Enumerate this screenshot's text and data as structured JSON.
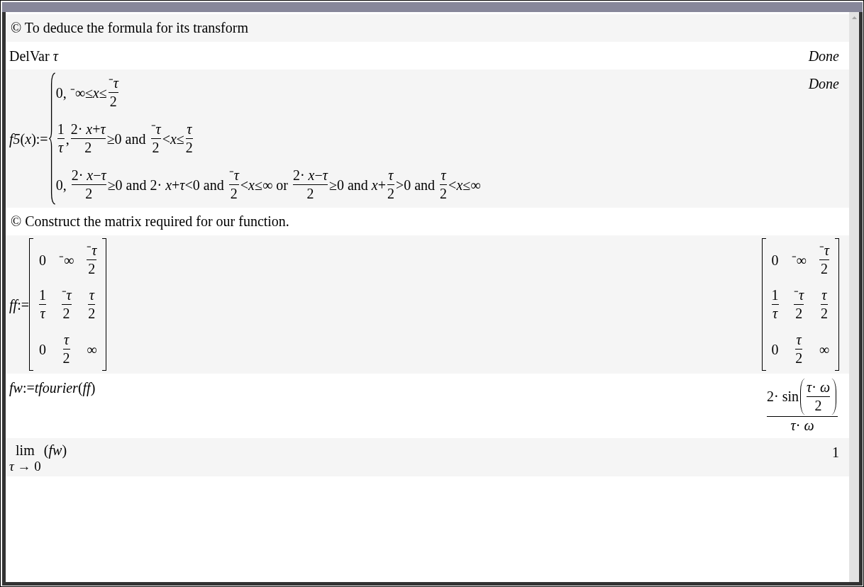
{
  "entries": [
    {
      "kind": "comment",
      "text": "© To deduce the formula for its transform"
    },
    {
      "kind": "math",
      "input": [
        {
          "kind": "text",
          "text": "DelVar *τ*"
        }
      ],
      "output": [
        {
          "kind": "text",
          "text": "Done",
          "italic": true
        }
      ]
    },
    {
      "kind": "math",
      "input": [
        {
          "kind": "text",
          "text": "*f5*(*x*):="
        },
        {
          "kind": "piecewise",
          "cases": [
            [
              {
                "kind": "text",
                "text": "0, ⁻∞≤*x*≤"
              },
              {
                "kind": "frac",
                "num": [
                  {
                    "kind": "text",
                    "text": "⁻*τ*"
                  }
                ],
                "den": [
                  {
                    "kind": "text",
                    "text": "2"
                  }
                ]
              }
            ],
            [
              {
                "kind": "frac",
                "num": [
                  {
                    "kind": "text",
                    "text": "1"
                  }
                ],
                "den": [
                  {
                    "kind": "text",
                    "text": "τ",
                    "italic": true
                  }
                ]
              },
              {
                "kind": "text",
                "text": ","
              },
              {
                "kind": "frac",
                "num": [
                  {
                    "kind": "text",
                    "text": "2· *x*+*τ*"
                  }
                ],
                "den": [
                  {
                    "kind": "text",
                    "text": "2"
                  }
                ]
              },
              {
                "kind": "text",
                "text": "≥0 and "
              },
              {
                "kind": "frac",
                "num": [
                  {
                    "kind": "text",
                    "text": "⁻*τ*"
                  }
                ],
                "den": [
                  {
                    "kind": "text",
                    "text": "2"
                  }
                ]
              },
              {
                "kind": "text",
                "text": "<*x*≤"
              },
              {
                "kind": "frac",
                "num": [
                  {
                    "kind": "text",
                    "text": "τ",
                    "italic": true
                  }
                ],
                "den": [
                  {
                    "kind": "text",
                    "text": "2"
                  }
                ]
              }
            ],
            [
              {
                "kind": "text",
                "text": "0, "
              },
              {
                "kind": "frac",
                "num": [
                  {
                    "kind": "text",
                    "text": "2· *x*−*τ*"
                  }
                ],
                "den": [
                  {
                    "kind": "text",
                    "text": "2"
                  }
                ]
              },
              {
                "kind": "text",
                "text": "≥0 and 2· *x*+*τ*<0 and "
              },
              {
                "kind": "frac",
                "num": [
                  {
                    "kind": "text",
                    "text": "⁻*τ*"
                  }
                ],
                "den": [
                  {
                    "kind": "text",
                    "text": "2"
                  }
                ]
              },
              {
                "kind": "text",
                "text": "<*x*≤∞ or "
              },
              {
                "kind": "frac",
                "num": [
                  {
                    "kind": "text",
                    "text": "2· *x*−*τ*"
                  }
                ],
                "den": [
                  {
                    "kind": "text",
                    "text": "2"
                  }
                ]
              },
              {
                "kind": "text",
                "text": "≥0 and *x*+"
              },
              {
                "kind": "frac",
                "num": [
                  {
                    "kind": "text",
                    "text": "τ",
                    "italic": true
                  }
                ],
                "den": [
                  {
                    "kind": "text",
                    "text": "2"
                  }
                ]
              },
              {
                "kind": "text",
                "text": ">0 and "
              },
              {
                "kind": "frac",
                "num": [
                  {
                    "kind": "text",
                    "text": "τ",
                    "italic": true
                  }
                ],
                "den": [
                  {
                    "kind": "text",
                    "text": "2"
                  }
                ]
              },
              {
                "kind": "text",
                "text": "<*x*≤∞"
              }
            ]
          ]
        }
      ],
      "output": [
        {
          "kind": "text",
          "text": "Done",
          "italic": true
        }
      ]
    },
    {
      "kind": "comment",
      "text": "© Construct the matrix required for our function."
    },
    {
      "kind": "math",
      "input": [
        {
          "kind": "text",
          "text": "*ff*:="
        },
        {
          "kind": "matrix",
          "rows": [
            [
              [
                {
                  "kind": "text",
                  "text": "0"
                }
              ],
              [
                {
                  "kind": "text",
                  "text": "⁻∞"
                }
              ],
              [
                {
                  "kind": "frac",
                  "num": [
                    {
                      "kind": "text",
                      "text": "⁻*τ*"
                    }
                  ],
                  "den": [
                    {
                      "kind": "text",
                      "text": "2"
                    }
                  ]
                }
              ]
            ],
            [
              [
                {
                  "kind": "frac",
                  "num": [
                    {
                      "kind": "text",
                      "text": "1"
                    }
                  ],
                  "den": [
                    {
                      "kind": "text",
                      "text": "τ",
                      "italic": true
                    }
                  ]
                }
              ],
              [
                {
                  "kind": "frac",
                  "num": [
                    {
                      "kind": "text",
                      "text": "⁻*τ*"
                    }
                  ],
                  "den": [
                    {
                      "kind": "text",
                      "text": "2"
                    }
                  ]
                }
              ],
              [
                {
                  "kind": "frac",
                  "num": [
                    {
                      "kind": "text",
                      "text": "τ",
                      "italic": true
                    }
                  ],
                  "den": [
                    {
                      "kind": "text",
                      "text": "2"
                    }
                  ]
                }
              ]
            ],
            [
              [
                {
                  "kind": "text",
                  "text": "0"
                }
              ],
              [
                {
                  "kind": "frac",
                  "num": [
                    {
                      "kind": "text",
                      "text": "τ",
                      "italic": true
                    }
                  ],
                  "den": [
                    {
                      "kind": "text",
                      "text": "2"
                    }
                  ]
                }
              ],
              [
                {
                  "kind": "text",
                  "text": "∞"
                }
              ]
            ]
          ]
        }
      ],
      "output": [
        {
          "kind": "matrix",
          "rows": [
            [
              [
                {
                  "kind": "text",
                  "text": "0"
                }
              ],
              [
                {
                  "kind": "text",
                  "text": "⁻∞"
                }
              ],
              [
                {
                  "kind": "frac",
                  "num": [
                    {
                      "kind": "text",
                      "text": "⁻*τ*"
                    }
                  ],
                  "den": [
                    {
                      "kind": "text",
                      "text": "2"
                    }
                  ]
                }
              ]
            ],
            [
              [
                {
                  "kind": "frac",
                  "num": [
                    {
                      "kind": "text",
                      "text": "1"
                    }
                  ],
                  "den": [
                    {
                      "kind": "text",
                      "text": "τ",
                      "italic": true
                    }
                  ]
                }
              ],
              [
                {
                  "kind": "frac",
                  "num": [
                    {
                      "kind": "text",
                      "text": "⁻*τ*"
                    }
                  ],
                  "den": [
                    {
                      "kind": "text",
                      "text": "2"
                    }
                  ]
                }
              ],
              [
                {
                  "kind": "frac",
                  "num": [
                    {
                      "kind": "text",
                      "text": "τ",
                      "italic": true
                    }
                  ],
                  "den": [
                    {
                      "kind": "text",
                      "text": "2"
                    }
                  ]
                }
              ]
            ],
            [
              [
                {
                  "kind": "text",
                  "text": "0"
                }
              ],
              [
                {
                  "kind": "frac",
                  "num": [
                    {
                      "kind": "text",
                      "text": "τ",
                      "italic": true
                    }
                  ],
                  "den": [
                    {
                      "kind": "text",
                      "text": "2"
                    }
                  ]
                }
              ],
              [
                {
                  "kind": "text",
                  "text": "∞"
                }
              ]
            ]
          ]
        }
      ]
    },
    {
      "kind": "math",
      "input": [
        {
          "kind": "text",
          "text": "*fw*:=*tfourier*(*ff*)"
        }
      ],
      "output": [
        {
          "kind": "frac",
          "num": [
            {
              "kind": "text",
              "text": "2· sin"
            },
            {
              "kind": "paren",
              "body": [
                {
                  "kind": "frac",
                  "num": [
                    {
                      "kind": "text",
                      "text": "*τ*· *ω*"
                    }
                  ],
                  "den": [
                    {
                      "kind": "text",
                      "text": "2"
                    }
                  ]
                }
              ]
            }
          ],
          "den": [
            {
              "kind": "text",
              "text": "*τ*· *ω*"
            }
          ]
        }
      ]
    },
    {
      "kind": "math",
      "input": [
        {
          "kind": "limit",
          "operator": "lim",
          "under": "*τ* → 0",
          "body": [
            {
              "kind": "text",
              "text": "(*fw*)"
            }
          ]
        }
      ],
      "output": [
        {
          "kind": "text",
          "text": "1"
        }
      ]
    }
  ]
}
